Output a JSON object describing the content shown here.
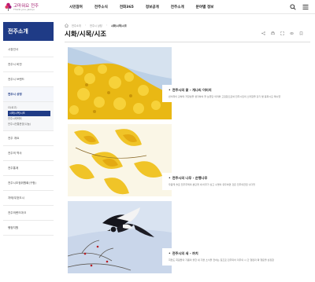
{
  "header": {
    "logo_text": "고마워요 전주",
    "logo_sub": "Thank you, Jeonju",
    "nav": [
      "시민참여",
      "전주소식",
      "전화365",
      "정보공개",
      "전주소개",
      "분야별 정보"
    ],
    "search_icon": "search-icon",
    "menu_icon": "hamburger-menu-icon"
  },
  "sidebar": {
    "title": "전주소개",
    "items": [
      {
        "label": "시장인사",
        "active": false
      },
      {
        "label": "전주시 비전",
        "active": false
      },
      {
        "label": "전주시 브랜드",
        "active": false
      },
      {
        "label": "전주시 상징",
        "active": true
      }
    ],
    "sub_items": [
      {
        "label": "CI(로고)",
        "active": false
      },
      {
        "label": "시화/시목/시조",
        "active": true
      },
      {
        "label": "전주시캐릭터",
        "active": false
      },
      {
        "label": "전주시전통문양(나눔)",
        "active": false
      }
    ],
    "items_after": [
      {
        "label": "전주 개요"
      },
      {
        "label": "전주의 역사"
      },
      {
        "label": "전주통계"
      },
      {
        "label": "전주시조정위원회(구청)"
      },
      {
        "label": "자매/우호도시"
      },
      {
        "label": "전주의랜드마크"
      },
      {
        "label": "행정지원"
      }
    ]
  },
  "breadcrumb": {
    "home_icon": "home-icon",
    "items": [
      "전주소개",
      "전주시 상징"
    ],
    "current": "시화/시목/시조"
  },
  "page": {
    "title": "시화/시목/시조",
    "util_icons": [
      "share-icon",
      "print-icon",
      "expand-icon",
      "link-icon",
      "bookmark-icon"
    ]
  },
  "symbols": [
    {
      "title": "전주시의 꽃 - 개나리 이미지",
      "desc": "번식력이 강하며 저항성을 생각하여 잘 보였던 의미와 고집함으로써 전주시민의 스러함을 강기 밟 동화시요 메시였"
    },
    {
      "title": "전주시의 나무 - 은행나무",
      "desc": "우람게 솔로 전주주택의 본단게 네 이무가 상고 수명이 유두하면 것은 전주의전입 니다엉"
    },
    {
      "title": "전주시의 새 - 까치",
      "desc": "희망도 희람들의 기쁨의 불한 새 기쁜 소식을 전하는 길조로 민주되어 미주의 시 간 형편과 확 행운을 상징함"
    }
  ],
  "colors": {
    "primary": "#1f3b86",
    "logo": "#a0196c",
    "forsythia": "#f2c21b",
    "ginkgo": "#f0c428",
    "sky": "#c9d6ea"
  }
}
